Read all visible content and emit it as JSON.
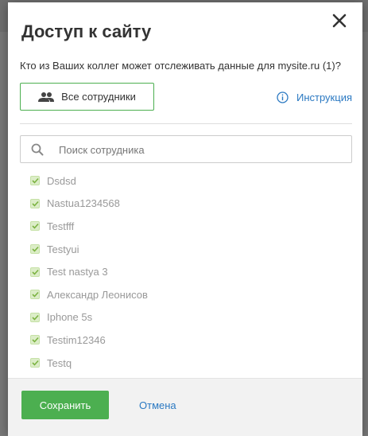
{
  "dialog": {
    "title": "Доступ к сайту",
    "subtitle": "Кто из Ваших коллег может отслеживать данные для mysite.ru (1)?",
    "all_employees_label": "Все сотрудники",
    "help_label": "Инструкция",
    "search": {
      "placeholder": "Поиск сотрудника",
      "value": ""
    },
    "employees": [
      {
        "name": "Dsdsd",
        "checked": true
      },
      {
        "name": "Nastua1234568",
        "checked": true
      },
      {
        "name": "Testfff",
        "checked": true
      },
      {
        "name": "Testyui",
        "checked": true
      },
      {
        "name": "Test nastya 3",
        "checked": true
      },
      {
        "name": "Александр Леонисов",
        "checked": true
      },
      {
        "name": "Iphone 5s",
        "checked": true
      },
      {
        "name": "Testim12346",
        "checked": true
      },
      {
        "name": "Testq",
        "checked": true
      }
    ],
    "save_label": "Сохранить",
    "cancel_label": "Отмена"
  },
  "colors": {
    "accent_green": "#4caf50",
    "link_blue": "#2b79c2",
    "checkbox_bg": "#dcedc8"
  },
  "icons": {
    "close": "close-icon",
    "group": "group-icon",
    "info": "info-icon",
    "search": "search-icon",
    "check": "check-icon"
  }
}
